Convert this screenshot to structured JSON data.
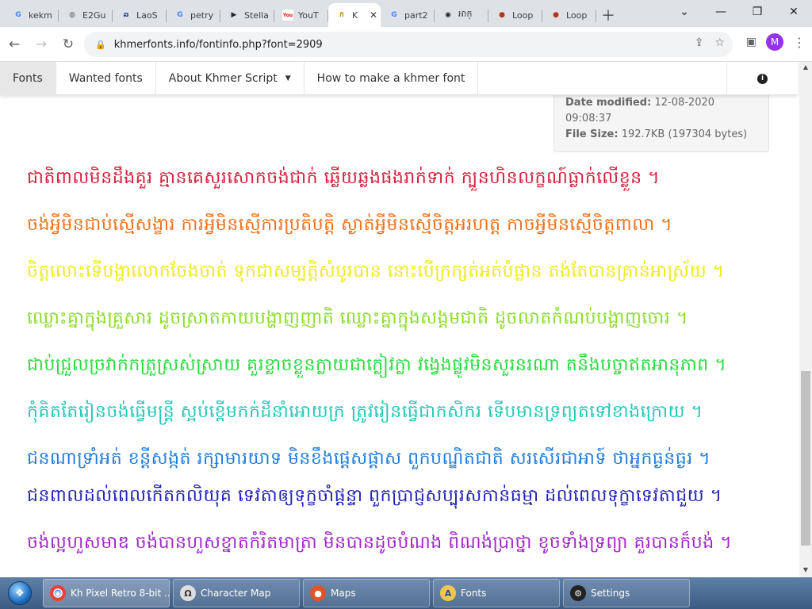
{
  "tabs": [
    {
      "title": "kekm",
      "favicon": "G",
      "favicon_color": "#4285f4"
    },
    {
      "title": "E2Gu",
      "favicon": "◍",
      "favicon_color": "#5f6368"
    },
    {
      "title": "LaoS",
      "favicon": "ລ",
      "favicon_color": "#1a3fa0"
    },
    {
      "title": "petry",
      "favicon": "G",
      "favicon_color": "#4285f4"
    },
    {
      "title": "Stella",
      "favicon": "▶",
      "favicon_color": "#1b2838"
    },
    {
      "title": "YouT",
      "favicon": "You",
      "favicon_color": "#ff0000"
    },
    {
      "title": "K",
      "favicon": "ក",
      "favicon_color": "#c08a2d",
      "active": true
    },
    {
      "title": "part2",
      "favicon": "G",
      "favicon_color": "#4285f4"
    },
    {
      "title": "អាក្",
      "favicon": "◉",
      "favicon_color": "#222222"
    },
    {
      "title": "Loop",
      "favicon": "●",
      "favicon_color": "#b8351f"
    },
    {
      "title": "Loop",
      "favicon": "●",
      "favicon_color": "#b8351f"
    }
  ],
  "address": {
    "url": "khmerfonts.info/fontinfo.php?font=2909",
    "avatar_letter": "M"
  },
  "sitenav": {
    "items": [
      {
        "label": "Fonts",
        "active": true
      },
      {
        "label": "Wanted fonts"
      },
      {
        "label": "About Khmer Script",
        "dropdown": true
      },
      {
        "label": "How to make a khmer font"
      }
    ]
  },
  "meta": {
    "date_label": "Date modified:",
    "date_value": "12-08-2020",
    "time_value": "09:08:37",
    "size_label": "File Size:",
    "size_value": "192.7KB (197304 bytes)"
  },
  "khmer_lines": [
    {
      "text": "ជាតិពាលមិនដឹងគួរ គ្មានគេសួរសោកចង់ជាក់ ឆ្លើយឆ្លងផងរាក់ទាក់ ក្បួនហិនលក្ខណ៍ធ្លាក់លើខ្លួន ។",
      "color": "#d4213d"
    },
    {
      "text": "ចង់អ្វីមិនជាប់ស្មើសង្ខារ ការអ្វីមិនស្មើការប្រតិបត្តិ ស្ងាត់អ្វីមិនស្មើចិត្តអរហត្ត កាចអ្វីមិនស្មើចិត្តពាលា ។",
      "color": "#f0711c"
    },
    {
      "text": "ចិត្តលោះទើបង្ហាលោកចែងចាត់ ទុកជាសម្បត្តិសំបូរបាន នោះបើក្រក្សត់អត់បំផ្លាន តង់តែបានគ្រាន់អាស្រ័យ ។",
      "color": "#eeea20"
    },
    {
      "text": "ឈ្លោះគ្នាក្នុងគ្រួសារ ដូចស្រាតកាយបង្ហាញញាតិ ឈ្លោះគ្នាក្នុងសង្គមជាតិ ដូចលាតកំណប់បង្ហាញចោរ ។",
      "color": "#8bdc2b"
    },
    {
      "text": "ជាប់ជ្រួលច្រវាក់កត្រួស្រស់ស្រាយ គួរខ្លាចខ្លួនក្លាយជាក្លៀវក្លា វង្វេងផ្លូវមិនសួរនរណា តនឹងបច្ចាឥតអានុភាព ។",
      "color": "#27dc3c"
    },
    {
      "text": "កុំគិតតែរៀនចង់ធ្វើមន្ត្រី ស្អប់ខ្ពើមកក់ដីនាំអោយក្រ ត្រូវរៀនធ្វើជាកសិករ ទើបមានទ្រព្យតទៅខាងក្រោយ ។",
      "color": "#25c8b8"
    },
    {
      "text": "ជនណាទ្រាំអត់ ខន្តីសង្កត់ រក្សាមារយាទ មិនខឹងផ្ដេសផ្ដាស ពួកបណ្ឌិតជាតិ សរសើរជាអាទ៍ ថាអ្នកធ្ងន់ធ្ងរ ។",
      "color": "#1f7de0"
    },
    {
      "text": "ជនពាលដល់ពេលកើតកលិយុគ ទេវតាឲ្យទុក្ខចាំផ្ដន្ទា ពួកប្រាជ្ញសប្បុរសកាន់ធម្មា ដល់ពេលទុក្ខាទេវតាជួយ ។",
      "color": "#2222b8"
    },
    {
      "text": "ចង់ល្អហួសមាឌ ចង់បានហួសខ្នាតកំរិតមាត្រា មិនបានដូចបំណង ពិណង់ប្រាថ្នា ខូចទាំងទ្រព្យា គួរបានក៏បង់ ។",
      "color": "#a226c9"
    }
  ],
  "taskbar": {
    "items": [
      {
        "label": "Kh Pixel Retro 8-bit ...",
        "icon": "chrome-icon"
      },
      {
        "label": "Character Map",
        "icon": "charmap-icon"
      },
      {
        "label": "Maps",
        "icon": "maps-icon"
      },
      {
        "label": "Fonts",
        "icon": "fonts-icon"
      },
      {
        "label": "Settings",
        "icon": "settings-icon"
      }
    ]
  }
}
